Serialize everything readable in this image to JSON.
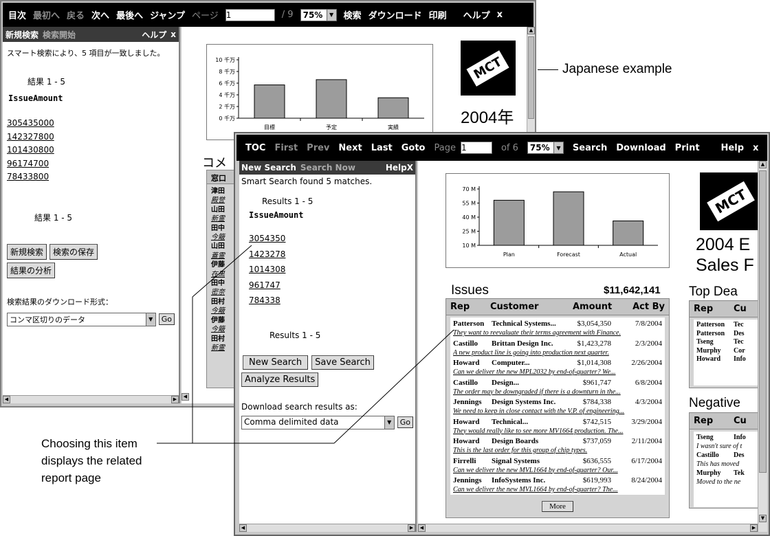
{
  "jp": {
    "toolbar": {
      "toc": "目次",
      "first": "最初へ",
      "prev": "戻る",
      "next": "次へ",
      "last": "最後へ",
      "goto": "ジャンプ",
      "page_label": "ページ",
      "page_value": "1",
      "of_pages": "/ 9",
      "zoom": "75%",
      "search": "検索",
      "download": "ダウンロード",
      "print": "印刷",
      "help": "ヘルプ",
      "close": "x"
    },
    "panel": {
      "new_search": "新規検索",
      "search_now": "検索開始",
      "help": "ヘルプ",
      "close": "x",
      "found": "スマート検索により、5 項目が一致しました。",
      "results": "結果 1 - 5",
      "field": "IssueAmount",
      "links": [
        "305435000",
        "142327800",
        "101430800",
        "96174700",
        "78433800"
      ],
      "results_bottom": "結果 1 - 5",
      "btn_new_search": "新規検索",
      "btn_save_search": "検索の保存",
      "btn_analyze": "結果の分析",
      "download_label": "検索結果のダウンロード形式：",
      "download_value": "コンマ区切りのデータ",
      "go": "Go"
    },
    "report": {
      "title_partial": "2004年",
      "issues_partial": "コメ",
      "table_head_partial": "窓口",
      "row_names": [
        "津田",
        "殿誉",
        "山田",
        "新霊",
        "田中",
        "今簸",
        "山田",
        "蓋霊",
        "伊藤",
        "在黒",
        "田中",
        "密奈",
        "田村",
        "今簸",
        "伊藤",
        "今簸",
        "田村",
        "新霊"
      ]
    },
    "chart_data": {
      "type": "bar",
      "categories": [
        "目標",
        "予定",
        "実績"
      ],
      "values": [
        57000000,
        66000000,
        35000000
      ],
      "y_ticks": [
        "10 千万",
        "8 千万",
        "6 千万",
        "4 千万",
        "2 千万",
        "0 千万"
      ],
      "ylim": [
        0,
        100000000
      ]
    },
    "callout": "Japanese example"
  },
  "en": {
    "toolbar": {
      "toc": "TOC",
      "first": "First",
      "prev": "Prev",
      "next": "Next",
      "last": "Last",
      "goto": "Goto",
      "page_label": "Page",
      "page_value": "1",
      "of_pages": "of 6",
      "zoom": "75%",
      "search": "Search",
      "download": "Download",
      "print": "Print",
      "help": "Help",
      "close": "x"
    },
    "panel": {
      "new_search": "New Search",
      "search_now": "Search Now",
      "help": "Help",
      "close": "X",
      "found": "Smart Search found 5 matches.",
      "results": "Results 1 - 5",
      "field": "IssueAmount",
      "links": [
        "3054350",
        "1423278",
        "1014308",
        "961747",
        "784338"
      ],
      "results_bottom": "Results 1 - 5",
      "btn_new_search": "New Search",
      "btn_save_search": "Save Search",
      "btn_analyze": "Analyze Results",
      "download_label": "Download search results as:",
      "download_value": "Comma delimited data",
      "go": "Go"
    },
    "report": {
      "title_line1": "2004 E",
      "title_line2": "Sales F",
      "issues_title": "Issues",
      "issues_total": "$11,642,141",
      "cols": [
        "Rep",
        "Customer",
        "Amount",
        "Act By"
      ],
      "rows": [
        {
          "rep": "Patterson",
          "customer": "Technical Systems...",
          "amount": "$3,054,350",
          "date": "7/8/2004",
          "note": "They want to reevaluate their terms agreement with Finance."
        },
        {
          "rep": "Castillo",
          "customer": "Brittan Design Inc.",
          "amount": "$1,423,278",
          "date": "2/3/2004",
          "note": "A new product line is going into production next quarter."
        },
        {
          "rep": "Howard",
          "customer": "Computer...",
          "amount": "$1,014,308",
          "date": "2/26/2004",
          "note": "Can we deliver the new MPL2032 by end-of-quarter? We..."
        },
        {
          "rep": "Castillo",
          "customer": "Design...",
          "amount": "$961,747",
          "date": "6/8/2004",
          "note": "The order may be downgraded if there is a downturn in the..."
        },
        {
          "rep": "Jennings",
          "customer": "Design Systems Inc.",
          "amount": "$784,338",
          "date": "4/3/2004",
          "note": "We need to keep in close contact with the V.P. of engineering..."
        },
        {
          "rep": "Howard",
          "customer": "Technical...",
          "amount": "$742,515",
          "date": "3/29/2004",
          "note": "They would really like to see more MV1664 production. The..."
        },
        {
          "rep": "Howard",
          "customer": "Design Boards",
          "amount": "$737,059",
          "date": "2/11/2004",
          "note": "This is the last order for this group of chip types."
        },
        {
          "rep": "Firrelli",
          "customer": "Signal Systems",
          "amount": "$636,555",
          "date": "6/17/2004",
          "note": "Can we deliver the new MVL1664 by end-of-quarter? Our..."
        },
        {
          "rep": "Jennings",
          "customer": "InfoSystems Inc.",
          "amount": "$619,993",
          "date": "8/24/2004",
          "note": "Can we deliver the new MVL1664 by end-of-quarter? The..."
        }
      ],
      "more": "More",
      "top_title": "Top Dea",
      "top_cols": [
        "Rep",
        "Cu"
      ],
      "top_rows": [
        {
          "rep": "Patterson",
          "cust": "Tec"
        },
        {
          "rep": "Patterson",
          "cust": "Des"
        },
        {
          "rep": "Tseng",
          "cust": "Tec"
        },
        {
          "rep": "Murphy",
          "cust": "Cor"
        },
        {
          "rep": "Howard",
          "cust": "Info"
        }
      ],
      "neg_title": "Negative",
      "neg_cols": [
        "Rep",
        "Cu"
      ],
      "neg_rows": [
        {
          "rep": "Tseng",
          "cust": "Info",
          "note": "I wasn't sure of t"
        },
        {
          "rep": "Castillo",
          "cust": "Des",
          "note": "This has moved"
        },
        {
          "rep": "Murphy",
          "cust": "Tek",
          "note": "Moved to the ne"
        }
      ]
    },
    "chart_data": {
      "type": "bar",
      "categories": [
        "Plan",
        "Forecast",
        "Actual"
      ],
      "values": [
        58,
        67,
        36
      ],
      "y_ticks": [
        "70 M",
        "55 M",
        "40 M",
        "25 M",
        "10 M"
      ],
      "ylim": [
        10,
        70
      ]
    }
  },
  "annotations": {
    "callout_bottom": [
      "Choosing this item",
      "displays the related",
      "report page"
    ]
  }
}
